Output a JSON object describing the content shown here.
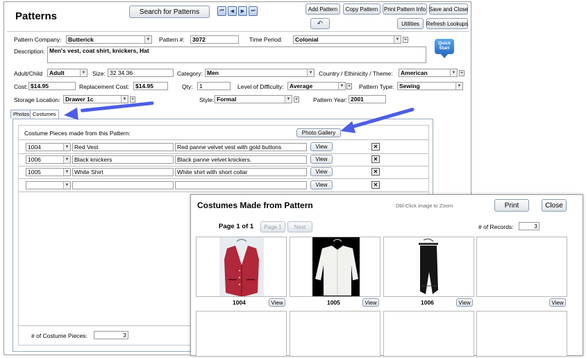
{
  "form": {
    "title": "Patterns",
    "search_label": "Search for Patterns",
    "nav": [
      "⏮",
      "◀",
      "▶",
      "⏭"
    ],
    "toolbar": {
      "add": "Add Pattern",
      "copy": "Copy Pattern",
      "print": "Print Pattern Info",
      "save_close": "Save and Close",
      "utilities": "Utilities",
      "refresh": "Refresh Lookups",
      "quick_start": "Quick Start"
    },
    "fields": {
      "company_label": "Pattern Company:",
      "company": "Butterick",
      "pattern_no_label": "Pattern #:",
      "pattern_no": "3072",
      "period_label": "Time Period:",
      "period": "Colonial",
      "description_label": "Description:",
      "description": "Men's vest, coat shirt, knickers, Hat",
      "adult_label": "Adult/Child",
      "adult": "Adult",
      "size_label": "Size:",
      "size": "32 34 36",
      "category_label": "Category:",
      "category": "Men",
      "country_label": "Country / Ethinicity / Theme:",
      "country": "American",
      "cost_label": "Cost:",
      "cost": "$14.95",
      "replacement_label": "Replacement Cost:",
      "replacement": "$14.95",
      "qty_label": "Qty:",
      "qty": "1",
      "difficulty_label": "Level of Difficulty:",
      "difficulty": "Average",
      "type_label": "Pattern Type:",
      "type": "Sewing",
      "storage_label": "Storage Location:",
      "storage": "Drawer 1c",
      "style_label": "Style:",
      "style": "Formal",
      "year_label": "Pattern Year:",
      "year": "2001"
    },
    "tabs": [
      "Photos",
      "Costumes"
    ],
    "costumes": {
      "heading": "Costume Pieces made from this Pattern:",
      "gallery_label": "Photo Gallery",
      "view_label": "View",
      "rows": [
        {
          "id": "1004",
          "name": "Red Vest",
          "desc": "Red panne velvet vest with gold buttons"
        },
        {
          "id": "1006",
          "name": "Black knickers",
          "desc": "Black panne velvet knickers."
        },
        {
          "id": "1005",
          "name": "White Shirt",
          "desc": "White shirt with short collar"
        }
      ],
      "count_label": "# of Costume Pieces:",
      "count": "3"
    }
  },
  "popup": {
    "title": "Costumes Made from Pattern",
    "hint": "Dbl-Click image to Zoom",
    "print": "Print",
    "close": "Close",
    "page_label": "Page",
    "page": "1",
    "of_label": "of",
    "pages": "1",
    "page_btn": "Page 1",
    "next_btn": "Next",
    "records_label": "# of Records:",
    "records": "3",
    "view_label": "View",
    "items": [
      {
        "id": "1004"
      },
      {
        "id": "1005"
      },
      {
        "id": "1006"
      }
    ]
  },
  "colors": {
    "arrow": "#4c5ee6",
    "accent": "#2a6fc4"
  }
}
